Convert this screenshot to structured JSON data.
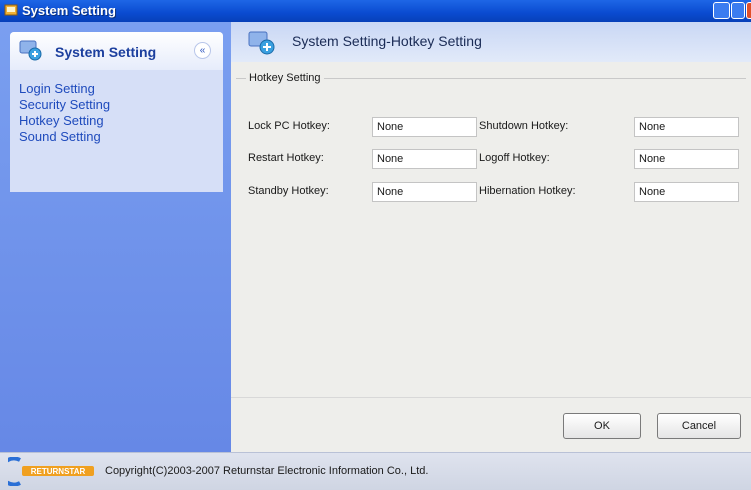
{
  "window": {
    "title": "System Setting"
  },
  "sidebar": {
    "header_title": "System Setting",
    "collapse_glyph": "«",
    "items": [
      {
        "label": "Login Setting"
      },
      {
        "label": "Security Setting"
      },
      {
        "label": "Hotkey Setting"
      },
      {
        "label": "Sound Setting"
      }
    ]
  },
  "main": {
    "header_title": "System Setting-Hotkey Setting",
    "group_title": "Hotkey Setting",
    "fields": [
      {
        "label": "Lock PC Hotkey:",
        "value": "None"
      },
      {
        "label": "Shutdown Hotkey:",
        "value": "None"
      },
      {
        "label": "Restart Hotkey:",
        "value": "None"
      },
      {
        "label": "Logoff Hotkey:",
        "value": "None"
      },
      {
        "label": "Standby Hotkey:",
        "value": "None"
      },
      {
        "label": "Hibernation Hotkey:",
        "value": "None"
      }
    ]
  },
  "buttons": {
    "ok": "OK",
    "cancel": "Cancel"
  },
  "footer": {
    "logo_text": "RETURNSTAR",
    "copyright": "Copyright(C)2003-2007 Returnstar Electronic Information Co., Ltd."
  },
  "icons": {
    "app": "app-icon",
    "sidebar_header": "settings-icon",
    "main_header": "settings-icon",
    "collapse": "chevron-up-icon"
  },
  "colors": {
    "titlebar": "#0a4bd0",
    "sidebar_bg": "#6f92ea",
    "sidebar_link": "#1f4bbd",
    "content_bg": "#eeeeeb"
  }
}
